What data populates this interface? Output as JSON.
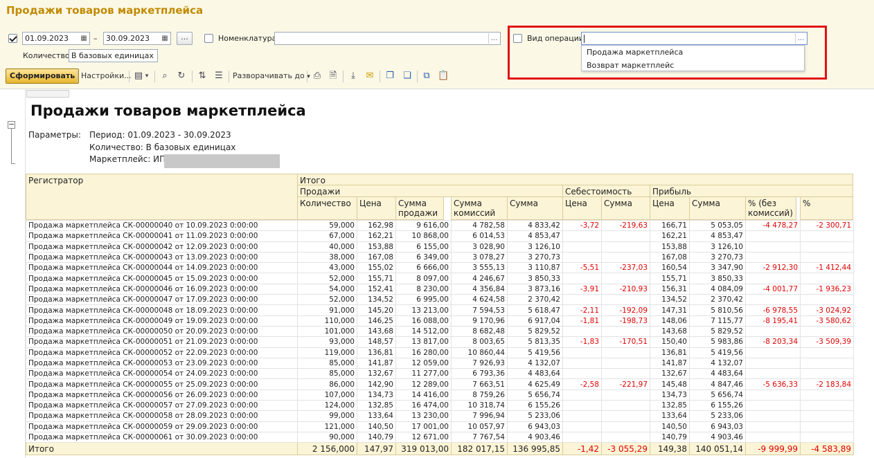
{
  "window": {
    "title": "Продажи товаров маркетплейса"
  },
  "filters": {
    "date_from": "01.09.2023",
    "date_sep": "–",
    "date_to": "30.09.2023",
    "ellipsis": "...",
    "nomenclature_label": "Номенклатура:",
    "nomenclature_value": "",
    "quantity_label": "Количество:",
    "quantity_value": "В базовых единицах",
    "operation_label": "Вид операции:",
    "operation_value": "",
    "operation_options": [
      "Продажа маркетплейса",
      "Возврат маркетплейс"
    ]
  },
  "toolbar": {
    "generate": "Сформировать",
    "settings": "Настройки...",
    "expand": "Разворачивать до"
  },
  "colors": {
    "accent": "#c28a00",
    "highlight": "#e01010",
    "header_bg": "#fbf4d6",
    "negative": "#e00000"
  },
  "report": {
    "title": "Продажи товаров маркетплейса",
    "params_label": "Параметры:",
    "period": "Период: 01.09.2023 - 30.09.2023",
    "quantity": "Количество: В базовых единицах",
    "marketplace": "Маркетплейс: ИП",
    "headers": {
      "registrar": "Регистратор",
      "total": "Итого",
      "sales": "Продажи",
      "cost": "Себестоимость",
      "profit": "Прибыль",
      "qty": "Количество",
      "price": "Цена",
      "sale_sum": "Сумма продажи",
      "commission_sum": "Сумма комиссий",
      "sum": "Сумма",
      "cost_price": "Цена",
      "cost_sum": "Сумма",
      "profit_price": "Цена",
      "profit_sum": "Сумма",
      "pct_no_comm": "% (без комиссий)",
      "pct": "%"
    },
    "rows": [
      [
        "Продажа маркетплейса СК-00000040 от 10.09.2023 0:00:00",
        "59,000",
        "162,98",
        "9 616,00",
        "4 782,58",
        "4 833,42",
        "-3,72",
        "-219,63",
        "166,71",
        "5 053,05",
        "-4 478,27",
        "-2 300,71"
      ],
      [
        "Продажа маркетплейса СК-00000041 от 11.09.2023 0:00:00",
        "67,000",
        "162,21",
        "10 868,00",
        "6 014,53",
        "4 853,47",
        "",
        "",
        "162,21",
        "4 853,47",
        "",
        ""
      ],
      [
        "Продажа маркетплейса СК-00000042 от 12.09.2023 0:00:00",
        "40,000",
        "153,88",
        "6 155,00",
        "3 028,90",
        "3 126,10",
        "",
        "",
        "153,88",
        "3 126,10",
        "",
        ""
      ],
      [
        "Продажа маркетплейса СК-00000043 от 13.09.2023 0:00:00",
        "38,000",
        "167,08",
        "6 349,00",
        "3 078,27",
        "3 270,73",
        "",
        "",
        "167,08",
        "3 270,73",
        "",
        ""
      ],
      [
        "Продажа маркетплейса СК-00000044 от 14.09.2023 0:00:00",
        "43,000",
        "155,02",
        "6 666,00",
        "3 555,13",
        "3 110,87",
        "-5,51",
        "-237,03",
        "160,54",
        "3 347,90",
        "-2 912,30",
        "-1 412,44"
      ],
      [
        "Продажа маркетплейса СК-00000045 от 15.09.2023 0:00:00",
        "52,000",
        "155,71",
        "8 097,00",
        "4 246,67",
        "3 850,33",
        "",
        "",
        "155,71",
        "3 850,33",
        "",
        ""
      ],
      [
        "Продажа маркетплейса СК-00000046 от 16.09.2023 0:00:00",
        "54,000",
        "152,41",
        "8 230,00",
        "4 356,84",
        "3 873,16",
        "-3,91",
        "-210,93",
        "156,31",
        "4 084,09",
        "-4 001,77",
        "-1 936,23"
      ],
      [
        "Продажа маркетплейса СК-00000047 от 17.09.2023 0:00:00",
        "52,000",
        "134,52",
        "6 995,00",
        "4 624,58",
        "2 370,42",
        "",
        "",
        "134,52",
        "2 370,42",
        "",
        ""
      ],
      [
        "Продажа маркетплейса СК-00000048 от 18.09.2023 0:00:00",
        "91,000",
        "145,20",
        "13 213,00",
        "7 594,53",
        "5 618,47",
        "-2,11",
        "-192,09",
        "147,31",
        "5 810,56",
        "-6 978,55",
        "-3 024,92"
      ],
      [
        "Продажа маркетплейса СК-00000049 от 19.09.2023 0:00:00",
        "110,000",
        "146,25",
        "16 088,00",
        "9 170,96",
        "6 917,04",
        "-1,81",
        "-198,73",
        "148,06",
        "7 115,77",
        "-8 195,41",
        "-3 580,62"
      ],
      [
        "Продажа маркетплейса СК-00000050 от 20.09.2023 0:00:00",
        "101,000",
        "143,68",
        "14 512,00",
        "8 682,48",
        "5 829,52",
        "",
        "",
        "143,68",
        "5 829,52",
        "",
        ""
      ],
      [
        "Продажа маркетплейса СК-00000051 от 21.09.2023 0:00:00",
        "93,000",
        "148,57",
        "13 817,00",
        "8 003,65",
        "5 813,35",
        "-1,83",
        "-170,51",
        "150,40",
        "5 983,86",
        "-8 203,34",
        "-3 509,39"
      ],
      [
        "Продажа маркетплейса СК-00000052 от 22.09.2023 0:00:00",
        "119,000",
        "136,81",
        "16 280,00",
        "10 860,44",
        "5 419,56",
        "",
        "",
        "136,81",
        "5 419,56",
        "",
        ""
      ],
      [
        "Продажа маркетплейса СК-00000053 от 23.09.2023 0:00:00",
        "85,000",
        "141,87",
        "12 059,00",
        "7 926,93",
        "4 132,07",
        "",
        "",
        "141,87",
        "4 132,07",
        "",
        ""
      ],
      [
        "Продажа маркетплейса СК-00000054 от 24.09.2023 0:00:00",
        "85,000",
        "132,67",
        "11 277,00",
        "6 793,36",
        "4 483,64",
        "",
        "",
        "132,67",
        "4 483,64",
        "",
        ""
      ],
      [
        "Продажа маркетплейса СК-00000055 от 25.09.2023 0:00:00",
        "86,000",
        "142,90",
        "12 289,00",
        "7 663,51",
        "4 625,49",
        "-2,58",
        "-221,97",
        "145,48",
        "4 847,46",
        "-5 636,33",
        "-2 183,84"
      ],
      [
        "Продажа маркетплейса СК-00000056 от 26.09.2023 0:00:00",
        "107,000",
        "134,73",
        "14 416,00",
        "8 759,26",
        "5 656,74",
        "",
        "",
        "134,73",
        "5 656,74",
        "",
        ""
      ],
      [
        "Продажа маркетплейса СК-00000057 от 27.09.2023 0:00:00",
        "124,000",
        "132,85",
        "16 474,00",
        "10 318,74",
        "6 155,26",
        "",
        "",
        "132,85",
        "6 155,26",
        "",
        ""
      ],
      [
        "Продажа маркетплейса СК-00000058 от 28.09.2023 0:00:00",
        "99,000",
        "133,64",
        "13 230,00",
        "7 996,94",
        "5 233,06",
        "",
        "",
        "133,64",
        "5 233,06",
        "",
        ""
      ],
      [
        "Продажа маркетплейса СК-00000059 от 29.09.2023 0:00:00",
        "121,000",
        "140,50",
        "17 001,00",
        "10 057,97",
        "6 943,03",
        "",
        "",
        "140,50",
        "6 943,03",
        "",
        ""
      ],
      [
        "Продажа маркетплейса СК-00000061 от 30.09.2023 0:00:00",
        "90,000",
        "140,79",
        "12 671,00",
        "7 767,54",
        "4 903,46",
        "",
        "",
        "140,79",
        "4 903,46",
        "",
        ""
      ]
    ],
    "total_row": [
      "Итого",
      "2 156,000",
      "147,97",
      "319 013,00",
      "182 017,15",
      "136 995,85",
      "-1,42",
      "-3 055,29",
      "149,38",
      "140 051,14",
      "-9 999,99",
      "-4 583,89"
    ]
  }
}
